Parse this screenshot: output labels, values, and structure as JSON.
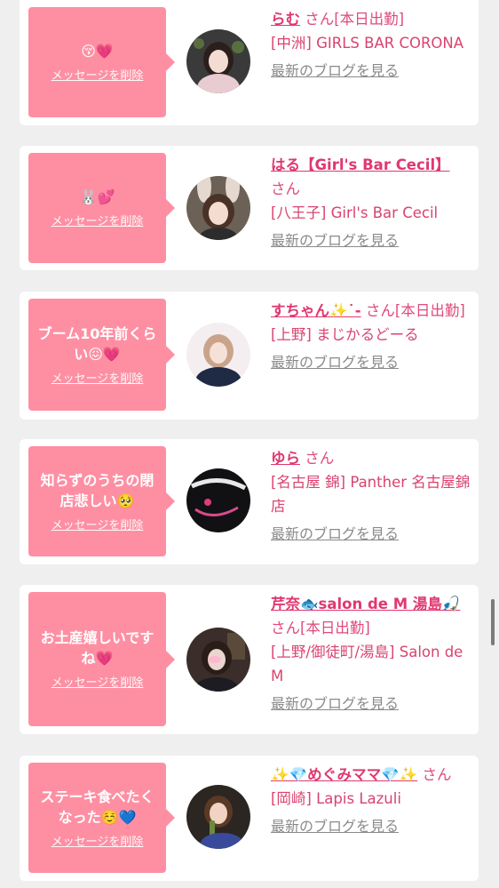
{
  "colors": {
    "bubble": "#fe8fa3",
    "name": "#e0386f",
    "text": "#e04b7a",
    "link_gray": "#8a8a8a",
    "background": "#efefef"
  },
  "delete_label": "メッセージを削除",
  "blog_label": "最新のブログを見る",
  "items": [
    {
      "message": "😚💗",
      "name": "らむ",
      "san": "さん[本日出勤]",
      "shop": "[中洲] GIRLS BAR CORONA"
    },
    {
      "message": "🐰💕",
      "name": "はる【Girl's Bar Cecil】",
      "san": "さん",
      "shop": "[八王子] Girl's Bar Cecil"
    },
    {
      "message": "ブーム10年前くらい😖💗",
      "name": "すちゃん✨˙-",
      "san": "さん[本日出勤]",
      "shop": "[上野] まじかるどーる"
    },
    {
      "message": "知らずのうちの閉店悲しい🥺",
      "name": "ゆら",
      "san": "さん",
      "shop": "[名古屋 錦] Panther 名古屋錦店"
    },
    {
      "message": "お土産嬉しいですね💗",
      "name": "芹奈🐟salon de M 湯島🎣",
      "san": "さん[本日出勤]",
      "shop": "[上野/御徒町/湯島] Salon de M"
    },
    {
      "message": "ステーキ食べたくなった☺️💙",
      "name": "✨💎めぐみママ💎✨",
      "san": "さん",
      "shop": "[岡崎] Lapis Lazuli"
    }
  ]
}
